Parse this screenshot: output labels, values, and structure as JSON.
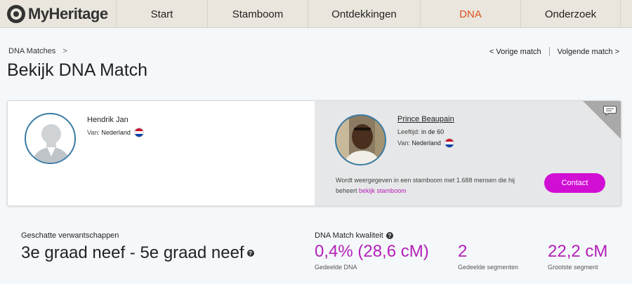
{
  "brand": {
    "name": "MyHeritage"
  },
  "nav": {
    "items": [
      {
        "label": "Start",
        "active": false
      },
      {
        "label": "Stamboom",
        "active": false
      },
      {
        "label": "Ontdekkingen",
        "active": false
      },
      {
        "label": "DNA",
        "active": true
      },
      {
        "label": "Onderzoek",
        "active": false
      }
    ]
  },
  "breadcrumb": {
    "parent": "DNA Matches",
    "sep": ">"
  },
  "page": {
    "title": "Bekijk DNA Match"
  },
  "pager": {
    "prev": "<  Vorige match",
    "next": "Volgende match  >"
  },
  "match": {
    "left": {
      "name": "Hendrik Jan",
      "from_label": "Van:",
      "country": "Nederland"
    },
    "right": {
      "name": "Prince Beaupain",
      "age_label": "Leeftijd:",
      "age": "in de 60",
      "from_label": "Van:",
      "country": "Nederland",
      "tree_info": "Wordt weergegeven in een stamboom met 1.688 mensen die hij beheert",
      "tree_link": "bekijk stamboom",
      "contact_label": "Contact"
    }
  },
  "stats": {
    "relationship_label": "Geschatte verwantschappen",
    "relationship_value": "3e graad neef - 5e graad neef",
    "quality_label": "DNA Match kwaliteit",
    "shared_dna": "0,4% (28,6 cM)",
    "shared_dna_label": "Gedeelde DNA",
    "segments": "2",
    "segments_label": "Gedeelde segmenten",
    "largest": "22,2 cM",
    "largest_label": "Grootste segment"
  },
  "colors": {
    "accent": "#d10fd4",
    "stat": "#b320b8",
    "active_nav": "#d9531e",
    "nav_bg": "#eae6dd"
  },
  "icons": {
    "help": "?",
    "chat": "chat-bubble-icon",
    "flag": "flag-netherlands-icon"
  }
}
